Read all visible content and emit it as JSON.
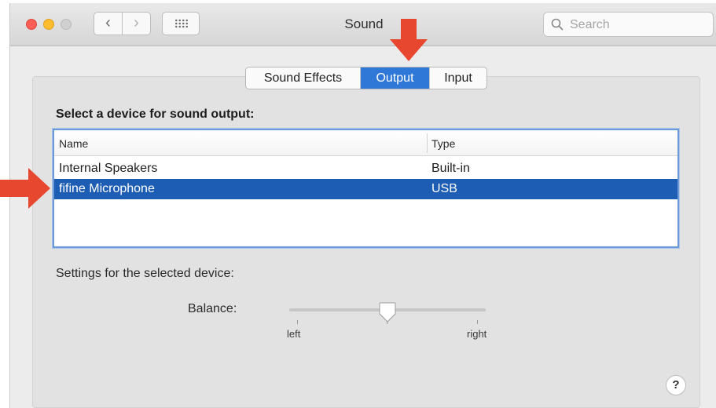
{
  "window": {
    "title": "Sound"
  },
  "toolbar": {
    "back_label": "‹",
    "forward_label": "›"
  },
  "search": {
    "placeholder": "Search"
  },
  "tabs": [
    {
      "label": "Sound Effects",
      "selected": false
    },
    {
      "label": "Output",
      "selected": true
    },
    {
      "label": "Input",
      "selected": false
    }
  ],
  "output": {
    "heading": "Select a device for sound output:",
    "columns": {
      "name": "Name",
      "type": "Type"
    },
    "devices": [
      {
        "name": "Internal Speakers",
        "type": "Built-in",
        "selected": false
      },
      {
        "name": "fifine Microphone",
        "type": "USB",
        "selected": true
      }
    ]
  },
  "settings": {
    "heading": "Settings for the selected device:",
    "balance_label": "Balance:",
    "balance_left": "left",
    "balance_right": "right",
    "balance_value": 0.5
  },
  "help": {
    "label": "?"
  },
  "colors": {
    "accent": "#2f78d8",
    "selection": "#1d5eb4",
    "annotation_arrow": "#e8472f"
  },
  "icons": [
    "close-light",
    "minimize-light",
    "zoom-light",
    "back-chevron-icon",
    "forward-chevron-icon",
    "grid-icon",
    "search-icon",
    "help-icon",
    "annotation-arrow-down",
    "annotation-arrow-right"
  ]
}
